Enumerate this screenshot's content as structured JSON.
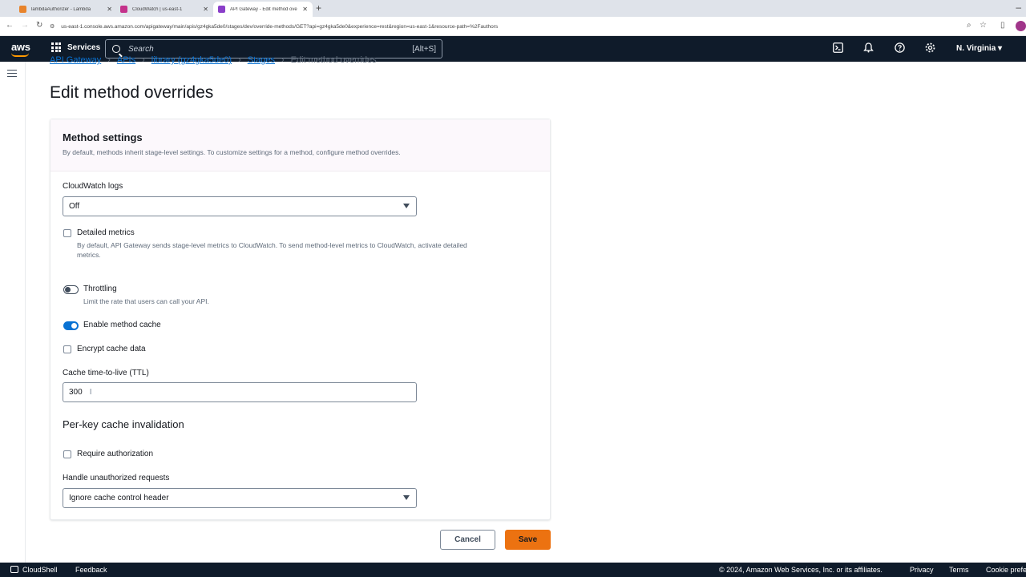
{
  "browser": {
    "tabs": [
      {
        "label": "lambdaAuthorizer - Lambda",
        "color": "#e8832b"
      },
      {
        "label": "CloudWatch | us-east-1",
        "color": "#c4328b"
      },
      {
        "label": "API Gateway - Edit method ove",
        "color": "#8a3ec9"
      }
    ],
    "new_tab": "+",
    "url": "us-east-1.console.aws.amazon.com/apigateway/main/apis/gz4gka5de0/stages/dev/override-methods/GET?api=gz4gka5de0&experience=rest&region=us-east-1&resource-path=%2Fauthors"
  },
  "nav": {
    "logo": "aws",
    "services": "Services",
    "search_placeholder": "Search",
    "search_shortcut": "[Alt+S]",
    "region": "N. Virginia ▾"
  },
  "breadcrumb": {
    "items": [
      "API Gateway",
      "APIs",
      "library (gz4gka5de0)",
      "Stages"
    ],
    "current": "Edit method overrides"
  },
  "page": {
    "title": "Edit method overrides"
  },
  "card": {
    "title": "Method settings",
    "description": "By default, methods inherit stage-level settings. To customize settings for a method, configure method overrides.",
    "cloudwatch_logs_label": "CloudWatch logs",
    "cloudwatch_logs_value": "Off",
    "detailed_metrics_label": "Detailed metrics",
    "detailed_metrics_desc_1": "By default, API Gateway sends stage-level metrics to CloudWatch. To send method-level metrics to CloudWatch, activate detailed",
    "detailed_metrics_desc_2": "metrics.",
    "throttling_label": "Throttling",
    "throttling_desc": "Limit the rate that users can call your API.",
    "enable_cache_label": "Enable method cache",
    "encrypt_label": "Encrypt cache data",
    "ttl_label": "Cache time-to-live (TTL)",
    "ttl_value": "300",
    "per_key_title": "Per-key cache invalidation",
    "require_auth_label": "Require authorization",
    "handle_unauth_label": "Handle unauthorized requests",
    "handle_unauth_value": "Ignore cache control header"
  },
  "actions": {
    "cancel": "Cancel",
    "save": "Save"
  },
  "footer": {
    "cloudshell": "CloudShell",
    "feedback": "Feedback",
    "copyright": "© 2024, Amazon Web Services, Inc. or its affiliates.",
    "privacy": "Privacy",
    "terms": "Terms",
    "cookie": "Cookie prefer"
  },
  "colors": {
    "accent": "#0972d3",
    "save_button": "#ec7211",
    "nav_bg": "#0f1b2a"
  }
}
